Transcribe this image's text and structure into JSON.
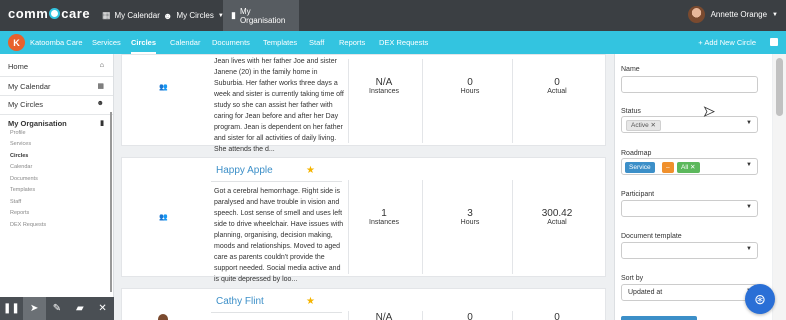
{
  "topbar": {
    "logo_left": "comm",
    "logo_right": "care",
    "nav": [
      {
        "label": "My Calendar",
        "icon": "calendar-icon"
      },
      {
        "label": "My Circles",
        "icon": "circles-icon"
      },
      {
        "label": "My Organisation",
        "icon": "building-icon"
      }
    ],
    "user_name": "Annette Orange"
  },
  "subbar": {
    "org_name": "Katoomba Care",
    "nav": [
      "Services",
      "Circles",
      "Calendar",
      "Documents",
      "Templates",
      "Staff",
      "Reports",
      "DEX Requests"
    ],
    "active": "Circles",
    "add_label": "+ Add New Circle"
  },
  "sidebar": {
    "items": [
      "Home",
      "My Calendar",
      "My Circles",
      "My Organisation"
    ],
    "sub_items": [
      "Profile",
      "Services",
      "Circles",
      "Calendar",
      "Documents",
      "Templates",
      "Staff",
      "Reports",
      "DEX Requests"
    ],
    "active_sub": "Circles"
  },
  "circles": [
    {
      "name": "",
      "description": "Jean lives with her father Joe and sister Janene (20) in the family home in Suburbia. Her father works three days a week and sister is currently taking time off study so she can assist her father with caring for Jean before and after her Day program. Jean is dependent on her father and sister for all activities of daily living. She attends the d...",
      "instances_value": "N/A",
      "instances_label": "Instances",
      "hours_value": "0",
      "hours_label": "Hours",
      "actual_value": "0",
      "actual_label": "Actual"
    },
    {
      "name": "Happy Apple",
      "description": "Got a cerebral hemorrhage. Right side is paralysed and have trouble in vision and speech. Lost sense of smell and uses left side to drive wheelchair. Have issues with planning, organising, decision making, moods and relationships. Moved to aged care as parents couldn't provide the support needed. Social media active and is quite depressed by loo...",
      "instances_value": "1",
      "instances_label": "Instances",
      "hours_value": "3",
      "hours_label": "Hours",
      "actual_value": "300.42",
      "actual_label": "Actual"
    },
    {
      "name": "Cathy Flint",
      "description": "",
      "instances_value": "N/A",
      "instances_label": "",
      "hours_value": "0",
      "hours_label": "",
      "actual_value": "0",
      "actual_label": ""
    }
  ],
  "filters": {
    "name_label": "Name",
    "name_value": "",
    "status_label": "Status",
    "status_tag": "Active",
    "roadmap_label": "Roadmap",
    "roadmap_tags": [
      "Service",
      "–",
      "All"
    ],
    "participant_label": "Participant",
    "participant_value": "",
    "doc_template_label": "Document template",
    "doc_template_value": "",
    "sort_label": "Sort by",
    "sort_value": "Updated at"
  },
  "toolbar": [
    "pause-icon",
    "pointer-icon",
    "pen-icon",
    "eraser-icon",
    "close-icon"
  ],
  "colors": {
    "accent": "#33c4e0",
    "topbar": "#3b3f43",
    "link": "#3c8fc8",
    "star": "#f5b400"
  }
}
